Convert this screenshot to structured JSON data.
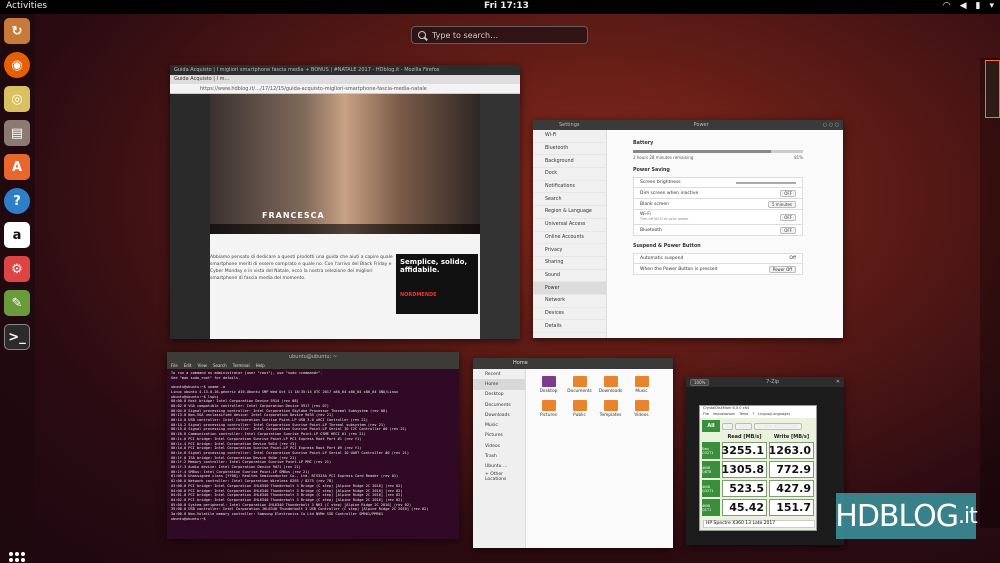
{
  "topbar": {
    "activities": "Activities",
    "clock": "Fri 17:13"
  },
  "search": {
    "placeholder": "Type to search…"
  },
  "dock": {
    "items": [
      "Software Updater",
      "Firefox",
      "Rhythmbox",
      "Files",
      "Ubuntu Software",
      "Help",
      "Amazon",
      "System Settings",
      "Screenshot",
      "Terminal"
    ]
  },
  "firefox": {
    "title": "Guida Acquisto | I migliori smartphone fascia media + BONUS | #NATALE 2017 - HDblog.it - Mozilla Firefox",
    "tab": "Guida Acquisto | I m…",
    "url": "https://www.hdblog.it/…/17/12/15/guida-acquisto-migliori-smartphone-fascia-media-natale",
    "video_name": "FRANCESCA",
    "ad_text": "Semplice, solido, affidabile.",
    "ad_brand": "NORDMENDE",
    "body": "Abbiamo pensato di dedicare a questi prodotti una guida che aiuti a capire quale smartphone meriti di essere comprato e quale no. Con l'arrivo del Black Friday e Cyber Monday e in vista del Natale, ecco la nostra selezione dei migliori smartphone di fascia media del momento."
  },
  "settings": {
    "nav_title": "Settings",
    "panel_title": "Power",
    "nav": [
      "Wi-Fi",
      "Bluetooth",
      "Background",
      "Dock",
      "Notifications",
      "Search",
      "Region & Language",
      "Universal Access",
      "Online Accounts",
      "Privacy",
      "Sharing",
      "Sound",
      "Power",
      "Network",
      "Devices",
      "Details"
    ],
    "battery_label": "Battery",
    "battery_text": "3 hours 28 minutes remaining",
    "battery_pct": "81%",
    "battery_level": 0.81,
    "power_saving": "Power Saving",
    "rows1": [
      {
        "label": "Screen brightness",
        "value": ""
      },
      {
        "label": "Dim screen when inactive",
        "value": "OFF"
      },
      {
        "label": "Blank screen",
        "value": "5 minutes"
      },
      {
        "label": "Wi-Fi",
        "value": "OFF"
      },
      {
        "label": "Bluetooth",
        "value": "OFF"
      }
    ],
    "wifi_sub": "Turn off Wi-Fi to save power",
    "suspend_title": "Suspend & Power Button",
    "rows2": [
      {
        "label": "Automatic suspend",
        "value": "Off"
      },
      {
        "label": "When the Power Button is pressed",
        "value": "Power Off"
      }
    ]
  },
  "terminal": {
    "title": "ubuntu@ubuntu: ~",
    "menu": [
      "File",
      "Edit",
      "View",
      "Search",
      "Terminal",
      "Help"
    ],
    "lines": [
      "To run a command as administrator (user \"root\"), use \"sudo <command>\".",
      "See \"man sudo_root\" for details.",
      "",
      "ubuntu@ubuntu:~$ uname -a",
      "Linux ubuntu 4.13.0-16-generic #19-Ubuntu SMP Wed Oct 11 18:35:14 UTC 2017 x86_64 x86_64 x86_64 GNU/Linux",
      "ubuntu@ubuntu:~$ lspci",
      "00:00.0 Host bridge: Intel Corporation Device 5914 (rev 08)",
      "00:02.0 VGA compatible controller: Intel Corporation Device 5917 (rev 07)",
      "00:04.0 Signal processing controller: Intel Corporation Skylake Processor Thermal Subsystem (rev 08)",
      "00:13.0 Non-VGA unclassified device: Intel Corporation Device 9d35 (rev 21)",
      "00:14.0 USB controller: Intel Corporation Sunrise Point-LP USB 3.0 xHCI Controller (rev 21)",
      "00:14.2 Signal processing controller: Intel Corporation Sunrise Point-LP Thermal subsystem (rev 21)",
      "00:15.0 Signal processing controller: Intel Corporation Sunrise Point-LP Serial IO I2C Controller #0 (rev 21)",
      "00:16.0 Communication controller: Intel Corporation Sunrise Point-LP CSME HECI #1 (rev 21)",
      "00:1c.0 PCI bridge: Intel Corporation Sunrise Point-LP PCI Express Root Port #1 (rev f1)",
      "00:1c.4 PCI bridge: Intel Corporation Device 9d14 (rev f1)",
      "00:1d.0 PCI bridge: Intel Corporation Sunrise Point-LP PCI Express Root Port #9 (rev f1)",
      "00:1e.0 Signal processing controller: Intel Corporation Sunrise Point-LP Serial IO UART Controller #0 (rev 21)",
      "00:1f.0 ISA bridge: Intel Corporation Device 9d4e (rev 21)",
      "00:1f.2 Memory controller: Intel Corporation Sunrise Point-LP PMC (rev 21)",
      "00:1f.3 Audio device: Intel Corporation Device 9d71 (rev 21)",
      "00:1f.4 SMBus: Intel Corporation Sunrise Point-LP SMBus (rev 21)",
      "01:00.0 Unassigned class [ff00]: Realtek Semiconductor Co., Ltd. RTS525A PCI Express Card Reader (rev 01)",
      "02:00.0 Network controller: Intel Corporation Wireless 8265 / 8275 (rev 78)",
      "03:00.0 PCI bridge: Intel Corporation JHL6340 Thunderbolt 3 Bridge (C step) [Alpine Ridge 2C 2016] (rev 02)",
      "04:00.0 PCI bridge: Intel Corporation JHL6340 Thunderbolt 3 Bridge (C step) [Alpine Ridge 2C 2016] (rev 02)",
      "04:01.0 PCI bridge: Intel Corporation JHL6340 Thunderbolt 3 Bridge (C step) [Alpine Ridge 2C 2016] (rev 02)",
      "04:02.0 PCI bridge: Intel Corporation JHL6340 Thunderbolt 3 Bridge (C step) [Alpine Ridge 2C 2016] (rev 02)",
      "05:00.0 System peripheral: Intel Corporation JHL6340 Thunderbolt 3 NHI (C step) [Alpine Ridge 2C 2016] (rev 02)",
      "39:00.0 USB controller: Intel Corporation JHL6340 Thunderbolt 3 USB Controller (C step) [Alpine Ridge 2C 2016] (rev 02)",
      "3a:00.0 Non-Volatile memory controller: Samsung Electronics Co Ltd NVMe SSD Controller SM961/PM961",
      "ubuntu@ubuntu:~$ "
    ]
  },
  "files": {
    "title": "Home",
    "sidebar": [
      "Recent",
      "Home",
      "Desktop",
      "Documents",
      "Downloads",
      "Music",
      "Pictures",
      "Videos",
      "Trash",
      "Ubuntu …",
      "+ Other Locations"
    ],
    "folders": [
      "Desktop",
      "Documents",
      "Downloads",
      "Music",
      "Pictures",
      "Public",
      "Templates",
      "Videos"
    ]
  },
  "crystal": {
    "title": "7-Zip",
    "zoom": "100%",
    "app_title": "CrystalDiskMark 6.0.0 x64",
    "menu": [
      "File",
      "Impostazioni",
      "Tema",
      "?",
      "Lingua(Language)"
    ],
    "runs": "5",
    "size": "1GiB",
    "drive": "C: 39% (87/225GiB)",
    "all_label": "All",
    "read_title": "Read [MB/s]",
    "write_title": "Write [MB/s]",
    "rows": [
      {
        "label": "Seq Q32T1",
        "read": "3255.1",
        "write": "1263.0"
      },
      {
        "label": "4KiB Q8T8",
        "read": "1305.8",
        "write": "772.9"
      },
      {
        "label": "4KiB Q32T1",
        "read": "523.5",
        "write": "427.9"
      },
      {
        "label": "4KiB Q1T1",
        "read": "45.42",
        "write": "151.7"
      }
    ],
    "footer": "HP Spectre X360 13 Late 2017"
  },
  "logo": {
    "main": "HDBLOG",
    "suffix": ".it"
  }
}
